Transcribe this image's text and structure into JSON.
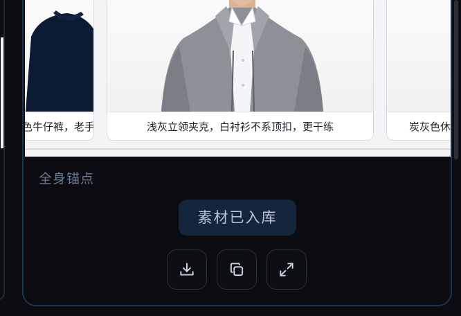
{
  "gallery": {
    "cards": [
      {
        "caption": "黑色牛仔裤，老手表"
      },
      {
        "caption": "浅灰立领夹克，白衬衫不系顶扣，更干练"
      },
      {
        "caption": "炭灰色休闲西装"
      }
    ]
  },
  "panel": {
    "section_label": "全身锚点",
    "status_label": "素材已入库",
    "actions": [
      {
        "icon": "download-icon"
      },
      {
        "icon": "copy-icon"
      },
      {
        "icon": "expand-icon"
      }
    ]
  },
  "colors": {
    "panel_border": "#1d3352",
    "status_bg": "#15253b",
    "background": "#0b0d12"
  }
}
